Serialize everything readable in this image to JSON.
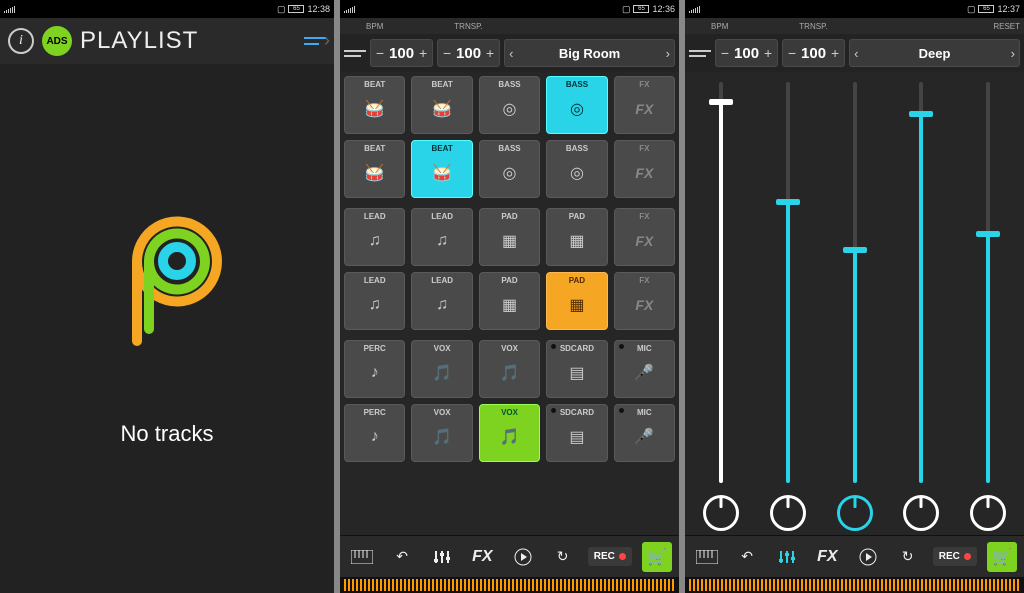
{
  "screen1": {
    "status": {
      "battery": "65",
      "time": "12:38"
    },
    "header": {
      "ads": "ADS",
      "title": "PLAYLIST"
    },
    "body": {
      "empty_text": "No tracks"
    }
  },
  "screen2": {
    "status": {
      "battery": "65",
      "time": "12:36"
    },
    "top_labels": {
      "bpm": "BPM",
      "transpose": "TRNSP."
    },
    "controls": {
      "bpm_value": "100",
      "transpose_value": "100",
      "preset": "Big Room"
    },
    "pads": {
      "group1": [
        [
          {
            "label": "BEAT",
            "icon": "drum",
            "state": ""
          },
          {
            "label": "BEAT",
            "icon": "drum",
            "state": ""
          },
          {
            "label": "BASS",
            "icon": "target",
            "state": ""
          },
          {
            "label": "BASS",
            "icon": "target",
            "state": "active-cyan"
          },
          {
            "label": "FX",
            "icon": "fx",
            "state": "fx"
          }
        ],
        [
          {
            "label": "BEAT",
            "icon": "drum",
            "state": ""
          },
          {
            "label": "BEAT",
            "icon": "drum",
            "state": "active-cyan"
          },
          {
            "label": "BASS",
            "icon": "target",
            "state": ""
          },
          {
            "label": "BASS",
            "icon": "target",
            "state": ""
          },
          {
            "label": "FX",
            "icon": "fx",
            "state": "fx"
          }
        ]
      ],
      "group2": [
        [
          {
            "label": "LEAD",
            "icon": "note",
            "state": ""
          },
          {
            "label": "LEAD",
            "icon": "note",
            "state": ""
          },
          {
            "label": "PAD",
            "icon": "grid",
            "state": ""
          },
          {
            "label": "PAD",
            "icon": "grid",
            "state": ""
          },
          {
            "label": "FX",
            "icon": "fx",
            "state": "fx"
          }
        ],
        [
          {
            "label": "LEAD",
            "icon": "note",
            "state": ""
          },
          {
            "label": "LEAD",
            "icon": "note",
            "state": ""
          },
          {
            "label": "PAD",
            "icon": "grid",
            "state": ""
          },
          {
            "label": "PAD",
            "icon": "grid",
            "state": "active-orange"
          },
          {
            "label": "FX",
            "icon": "fx",
            "state": "fx"
          }
        ]
      ],
      "group3": [
        [
          {
            "label": "PERC",
            "icon": "perc",
            "state": ""
          },
          {
            "label": "VOX",
            "icon": "vox",
            "state": ""
          },
          {
            "label": "VOX",
            "icon": "vox",
            "state": ""
          },
          {
            "label": "SDCARD",
            "icon": "sd",
            "state": "",
            "dot": true
          },
          {
            "label": "MIC",
            "icon": "mic",
            "state": "",
            "dot": true
          }
        ],
        [
          {
            "label": "PERC",
            "icon": "perc",
            "state": ""
          },
          {
            "label": "VOX",
            "icon": "vox",
            "state": ""
          },
          {
            "label": "VOX",
            "icon": "vox",
            "state": "active-green"
          },
          {
            "label": "SDCARD",
            "icon": "sd",
            "state": "",
            "dot": true
          },
          {
            "label": "MIC",
            "icon": "mic",
            "state": "",
            "dot": true
          }
        ]
      ]
    },
    "footer": {
      "rec": "REC"
    }
  },
  "screen3": {
    "status": {
      "battery": "65",
      "time": "12:37"
    },
    "top_labels": {
      "bpm": "BPM",
      "transpose": "TRNSP.",
      "reset": "RESET"
    },
    "controls": {
      "bpm_value": "100",
      "transpose_value": "100",
      "preset": "Deep"
    },
    "mixer": {
      "channels": [
        {
          "level": 0.95,
          "color": "#ffffff",
          "knob": "white"
        },
        {
          "level": 0.7,
          "color": "#29d3e8",
          "knob": "white"
        },
        {
          "level": 0.58,
          "color": "#29d3e8",
          "knob": "cyan"
        },
        {
          "level": 0.92,
          "color": "#29d3e8",
          "knob": "white"
        },
        {
          "level": 0.62,
          "color": "#29d3e8",
          "knob": "white"
        }
      ]
    },
    "footer": {
      "rec": "REC"
    }
  },
  "colors": {
    "accent_green": "#7ed321",
    "accent_cyan": "#29d3e8",
    "accent_orange": "#f5a623"
  }
}
